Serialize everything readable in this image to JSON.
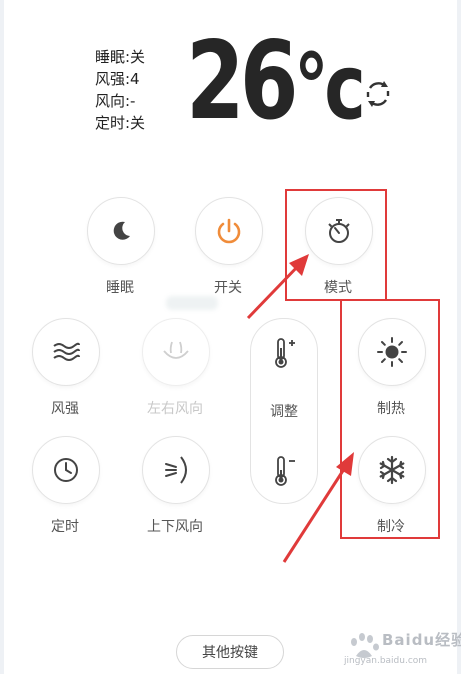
{
  "status": {
    "sleep": "睡眠:关",
    "fan_speed": "风强:4",
    "direction": "风向:-",
    "timer": "定时:关"
  },
  "temperature": {
    "value": "26",
    "unit": "°c"
  },
  "buttons": {
    "sleep": {
      "label": "睡眠",
      "icon": "moon-icon"
    },
    "power": {
      "label": "开关",
      "icon": "power-icon",
      "color": "#f08c3a"
    },
    "mode": {
      "label": "模式",
      "icon": "stopwatch-icon"
    },
    "fan": {
      "label": "风强",
      "icon": "wind-icon"
    },
    "swing_horizontal": {
      "label": "左右风向",
      "icon": "horizontal-swing-icon",
      "enabled": false
    },
    "timer": {
      "label": "定时",
      "icon": "clock-icon"
    },
    "swing_vertical": {
      "label": "上下风向",
      "icon": "vertical-swing-icon"
    },
    "adjust": {
      "label": "调整",
      "up_icon": "thermometer-plus-icon",
      "down_icon": "thermometer-minus-icon"
    },
    "heat": {
      "label": "制热",
      "icon": "sun-icon"
    },
    "cool": {
      "label": "制冷",
      "icon": "snowflake-icon"
    }
  },
  "other_keys_label": "其他按键",
  "watermark": {
    "text": "Baidu经验",
    "url": "jingyan.baidu.com"
  },
  "colors": {
    "annotation": "#e03a3a",
    "power_accent": "#f08c3a"
  }
}
